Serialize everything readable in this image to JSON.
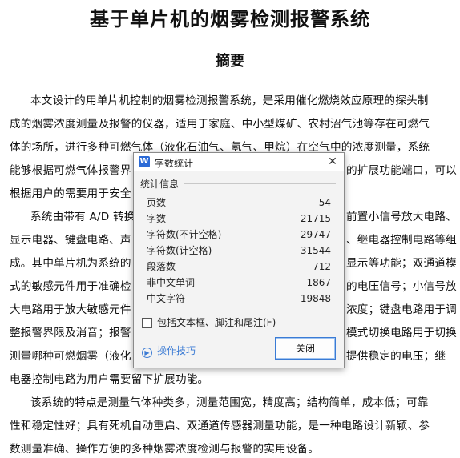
{
  "document": {
    "title": "基于单片机的烟雾检测报警系统",
    "section_title": "摘要",
    "lines": [
      "本文设计的用单片机控制的烟雾检测报警系统，是采用催化燃烧效应原理的探头制",
      "成的烟雾浓度测量及报警的仪器，适用于家庭、中小型煤矿、农村沼气池等存在可燃气",
      "体的场所，进行多种可燃气体（液化石油气、氢气、甲烷）在空气中的浓度测量，系统",
      "能够根据可燃气体报警界",
      "的扩展功能端口，可以",
      "根据用户的需要用于安全",
      "系统由带有 A/D 转换",
      "前置小信号放大电路、",
      "显示电器、键盘电路、声",
      "、继电器控制电路等组",
      "成。其中单片机为系统的",
      "显示等功能；双通道模",
      "式的敏感元件用于准确检",
      "的电压信号；小信号放",
      "大电路用于放大敏感元件",
      "浓度；键盘电路用于调",
      "整报警界限及消音；报警",
      "模式切换电路用于切换",
      "测量哪种可燃烟雾（液化",
      "提供稳定的电压；继",
      "电器控制电路为用户需要留下扩展功能。",
      "该系统的特点是测量气体种类多，测量范围宽，精度高；结构简单，成本低；可靠",
      "性和稳定性好；具有死机自动重启、双通道传感器测量功能，是一种电路设计新颖、参",
      "数测量准确、操作方便的多种烟雾浓度检测与报警的实用设备。"
    ]
  },
  "dialog": {
    "app_icon_letter": "W",
    "title": "字数统计",
    "close_glyph": "✕",
    "group_label": "统计信息",
    "stats": [
      {
        "label": "页数",
        "value": "54"
      },
      {
        "label": "字数",
        "value": "21715"
      },
      {
        "label": "字符数(不计空格)",
        "value": "29747"
      },
      {
        "label": "字符数(计空格)",
        "value": "31544"
      },
      {
        "label": "段落数",
        "value": "712"
      },
      {
        "label": "非中文单词",
        "value": "1867"
      },
      {
        "label": "中文字符",
        "value": "19848"
      }
    ],
    "checkbox_label": "包括文本框、脚注和尾注(F)",
    "tips_link": "操作技巧",
    "close_button": "关闭"
  }
}
